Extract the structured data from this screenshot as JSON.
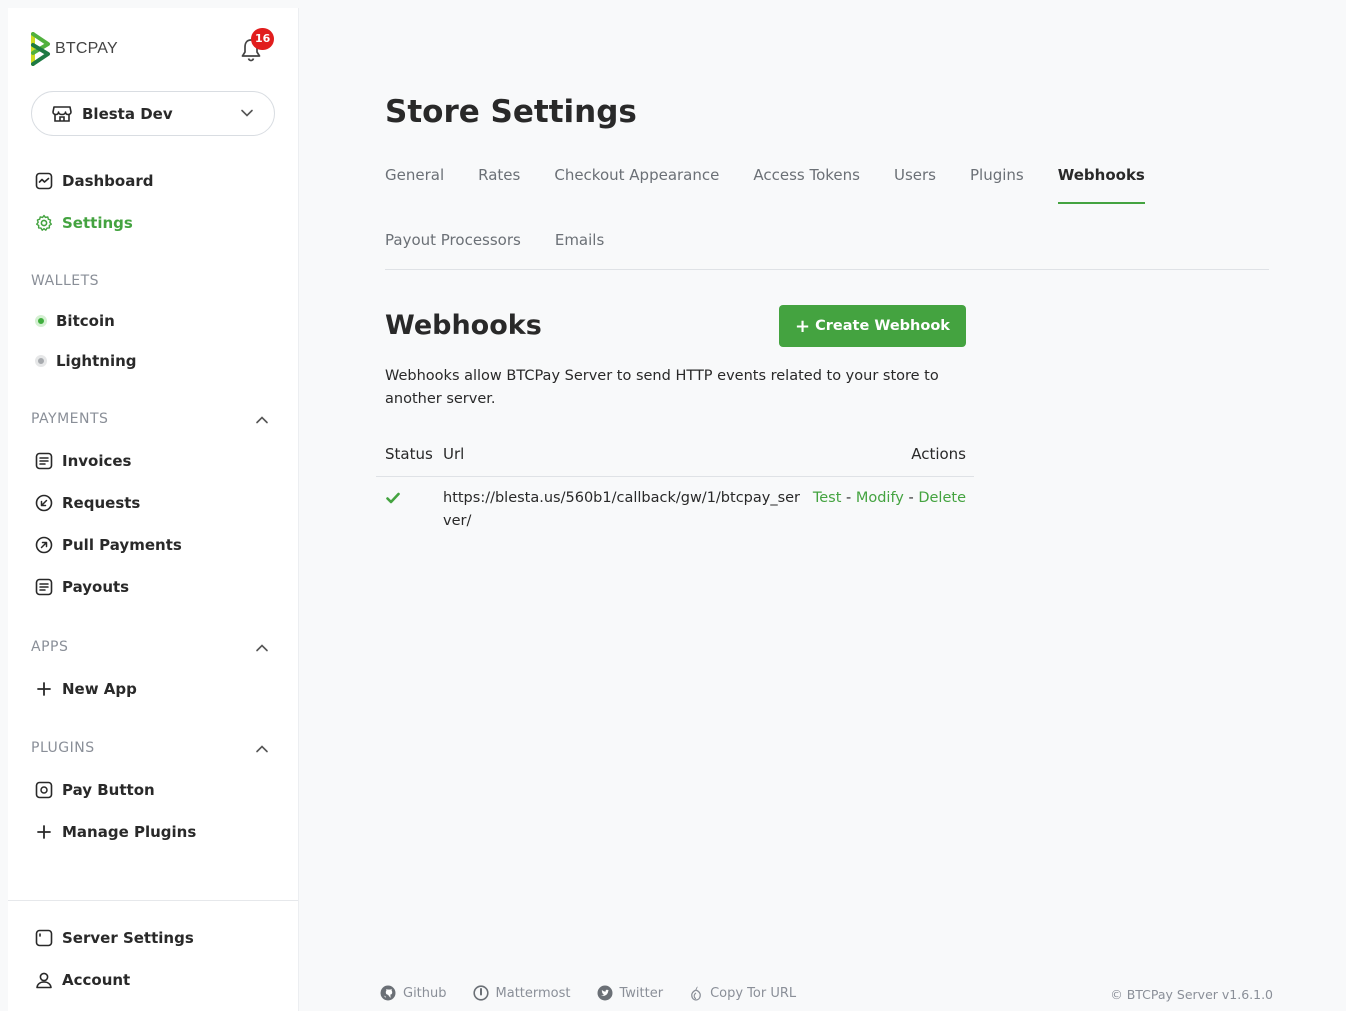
{
  "brand": {
    "name": "BTCPAY",
    "notification_count": "16"
  },
  "store": {
    "name": "Blesta Dev"
  },
  "nav": {
    "dashboard": "Dashboard",
    "settings": "Settings",
    "wallets_label": "WALLETS",
    "bitcoin": "Bitcoin",
    "lightning": "Lightning",
    "payments_label": "PAYMENTS",
    "invoices": "Invoices",
    "requests": "Requests",
    "pull_payments": "Pull Payments",
    "payouts": "Payouts",
    "apps_label": "APPS",
    "new_app": "New App",
    "plugins_label": "PLUGINS",
    "pay_button": "Pay Button",
    "manage_plugins": "Manage Plugins",
    "server_settings": "Server Settings",
    "account": "Account"
  },
  "page": {
    "title": "Store Settings"
  },
  "tabs": [
    {
      "label": "General"
    },
    {
      "label": "Rates"
    },
    {
      "label": "Checkout Appearance"
    },
    {
      "label": "Access Tokens"
    },
    {
      "label": "Users"
    },
    {
      "label": "Plugins"
    },
    {
      "label": "Webhooks",
      "active": true
    },
    {
      "label": "Payout Processors"
    },
    {
      "label": "Emails"
    }
  ],
  "webhooks": {
    "title": "Webhooks",
    "create_label": "Create Webhook",
    "description": "Webhooks allow BTCPay Server to send HTTP events related to your store to another server.",
    "columns": {
      "status": "Status",
      "url": "Url",
      "actions": "Actions"
    },
    "rows": [
      {
        "status": "success",
        "url": "https://blesta.us/560b1/callback/gw/1/btcpay_server/",
        "actions": {
          "test": "Test",
          "modify": "Modify",
          "delete": "Delete",
          "separator": "-"
        }
      }
    ]
  },
  "footer": {
    "github": "Github",
    "mattermost": "Mattermost",
    "twitter": "Twitter",
    "tor": "Copy Tor URL",
    "copyright": "© BTCPay Server v1.6.1.0"
  },
  "colors": {
    "accent": "#44a340",
    "badge": "#e11d1d",
    "muted": "#8a8f98"
  }
}
